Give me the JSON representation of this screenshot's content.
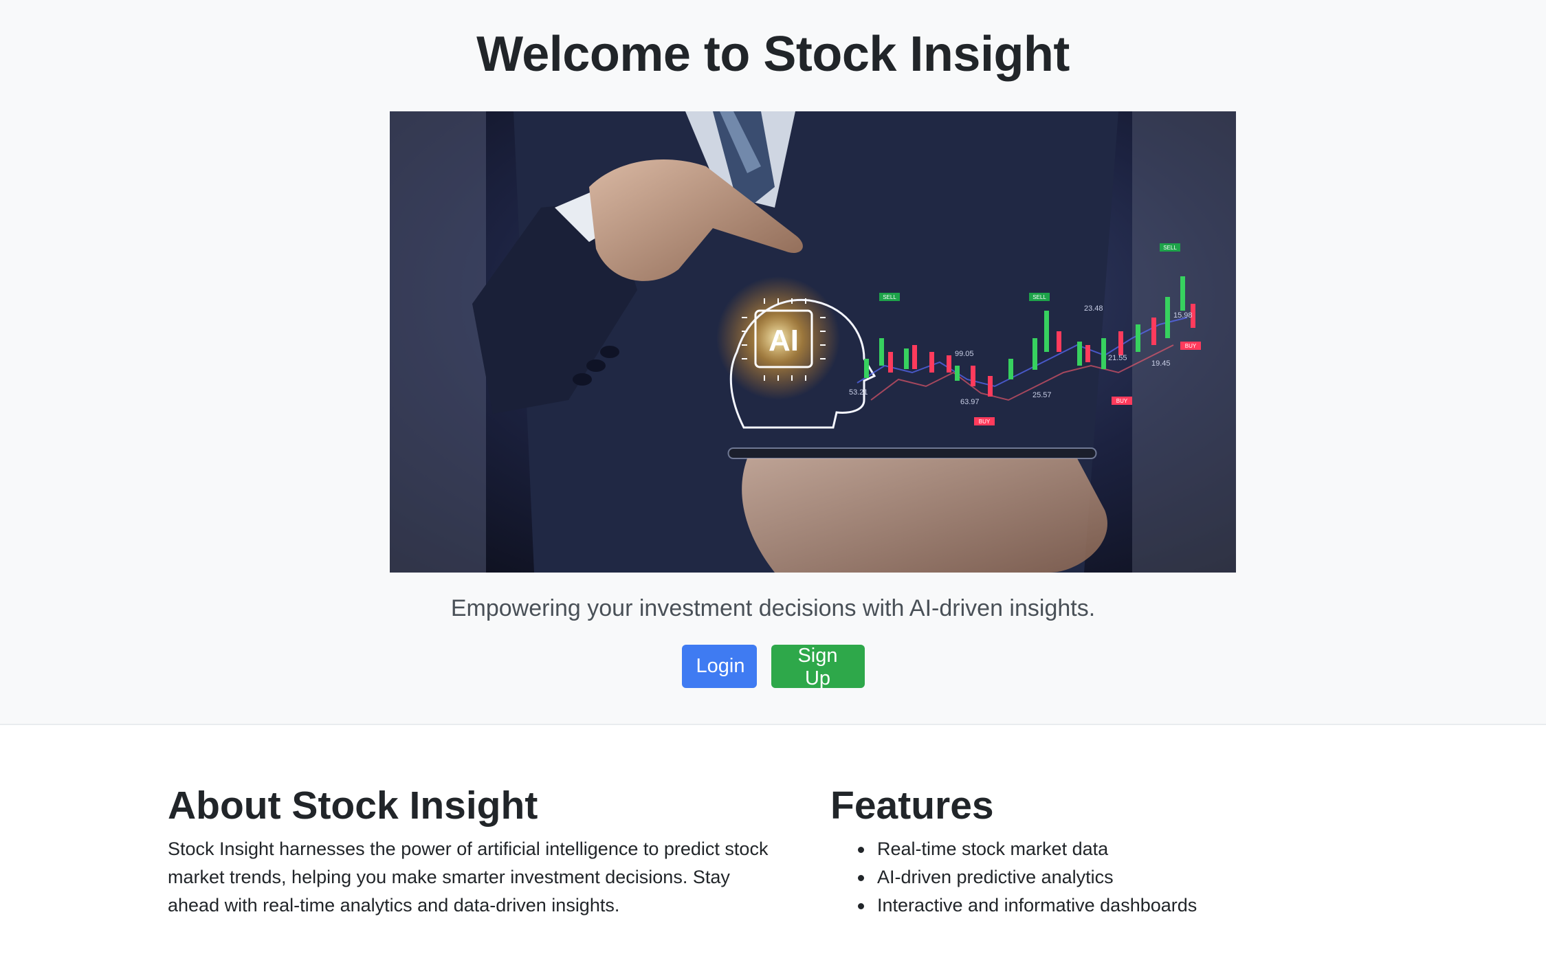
{
  "hero": {
    "title": "Welcome to Stock Insight",
    "image_overlay": {
      "ai_badge": "AI",
      "labels": [
        "SELL",
        "SELL",
        "SELL",
        "BUY",
        "BUY",
        "BUY",
        "53.21",
        "99.05",
        "63.97",
        "25.57",
        "23.48",
        "21.55",
        "19.45",
        "15.98"
      ]
    },
    "tagline": "Empowering your investment decisions with AI-driven insights.",
    "login_label": "Login",
    "signup_label": "Sign Up"
  },
  "about": {
    "heading": "About Stock Insight",
    "body": "Stock Insight harnesses the power of artificial intelligence to predict stock market trends, helping you make smarter investment decisions. Stay ahead with real-time analytics and data-driven insights."
  },
  "features": {
    "heading": "Features",
    "items": [
      "Real-time stock market data",
      "AI-driven predictive analytics",
      "Interactive and informative dashboards"
    ]
  },
  "colors": {
    "primary_button": "#3f7bf2",
    "success_button": "#2ea84a",
    "hero_background": "#f8f9fa",
    "candle_up": "#37d15f",
    "candle_down": "#ff3b5c"
  }
}
